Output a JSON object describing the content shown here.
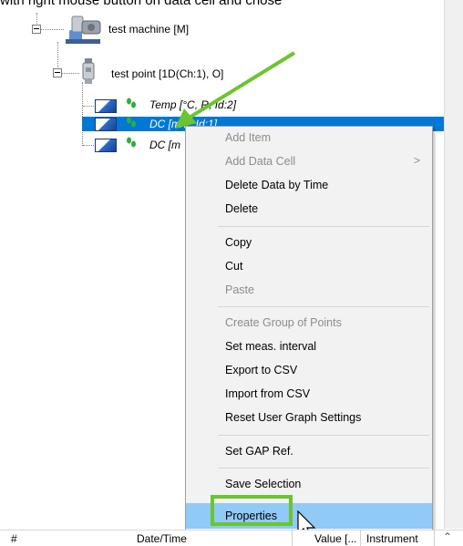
{
  "caption": "with right mouse button on data cell and chose",
  "tree": {
    "machine_label": "test machine [M]",
    "point_label": "test point [1D(Ch:1), O]",
    "cells": [
      {
        "label": "Temp [°C, R, Id:2]"
      },
      {
        "label": "DC [m/... Id:1]"
      },
      {
        "label": "DC [m"
      }
    ]
  },
  "context_menu": {
    "items": [
      {
        "label": "Add Item",
        "disabled": true
      },
      {
        "label": "Add Data Cell",
        "disabled": true,
        "submenu_arrow": ">"
      },
      {
        "label": "Delete Data by Time"
      },
      {
        "label": "Delete"
      },
      {
        "label": "Copy"
      },
      {
        "label": "Cut"
      },
      {
        "label": "Paste",
        "disabled": true
      },
      {
        "label": "Create Group of Points",
        "disabled": true
      },
      {
        "label": "Set meas. interval"
      },
      {
        "label": "Export to CSV"
      },
      {
        "label": "Import from CSV"
      },
      {
        "label": "Reset User Graph Settings"
      },
      {
        "label": "Set GAP Ref."
      },
      {
        "label": "Save Selection"
      },
      {
        "label": "Properties",
        "highlighted": true
      }
    ]
  },
  "table_header": {
    "col_number": "#",
    "col_datetime": "Date/Time",
    "col_value": "Value [...",
    "col_instrument": "Instrument"
  },
  "colors": {
    "selection": "#0078d7",
    "menu_hover": "#91c9f7",
    "annotation_green": "#6bc52e"
  }
}
